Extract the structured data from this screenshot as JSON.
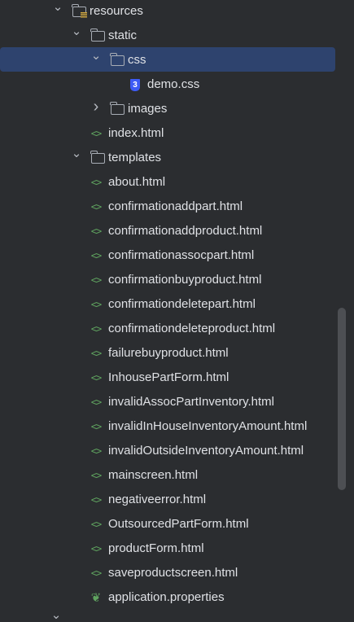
{
  "tree": [
    {
      "label": "resources",
      "type": "resources-folder",
      "depth": 0,
      "expanded": true
    },
    {
      "label": "static",
      "type": "folder",
      "depth": 1,
      "expanded": true
    },
    {
      "label": "css",
      "type": "folder",
      "depth": 2,
      "expanded": true,
      "selected": true
    },
    {
      "label": "demo.css",
      "type": "css",
      "depth": 3
    },
    {
      "label": "images",
      "type": "folder",
      "depth": 2,
      "expanded": false
    },
    {
      "label": "index.html",
      "type": "html",
      "depth": 2
    },
    {
      "label": "templates",
      "type": "folder",
      "depth": 1,
      "expanded": true
    },
    {
      "label": "about.html",
      "type": "html",
      "depth": 2
    },
    {
      "label": "confirmationaddpart.html",
      "type": "html",
      "depth": 2
    },
    {
      "label": "confirmationaddproduct.html",
      "type": "html",
      "depth": 2
    },
    {
      "label": "confirmationassocpart.html",
      "type": "html",
      "depth": 2
    },
    {
      "label": "confirmationbuyproduct.html",
      "type": "html",
      "depth": 2
    },
    {
      "label": "confirmationdeletepart.html",
      "type": "html",
      "depth": 2
    },
    {
      "label": "confirmationdeleteproduct.html",
      "type": "html",
      "depth": 2
    },
    {
      "label": "failurebuyproduct.html",
      "type": "html",
      "depth": 2
    },
    {
      "label": "InhousePartForm.html",
      "type": "html",
      "depth": 2
    },
    {
      "label": "invalidAssocPartInventory.html",
      "type": "html",
      "depth": 2
    },
    {
      "label": "invalidInHouseInventoryAmount.html",
      "type": "html",
      "depth": 2
    },
    {
      "label": "invalidOutsideInventoryAmount.html",
      "type": "html",
      "depth": 2
    },
    {
      "label": "mainscreen.html",
      "type": "html",
      "depth": 2
    },
    {
      "label": "negativeerror.html",
      "type": "html",
      "depth": 2
    },
    {
      "label": "OutsourcedPartForm.html",
      "type": "html",
      "depth": 2
    },
    {
      "label": "productForm.html",
      "type": "html",
      "depth": 2
    },
    {
      "label": "saveproductscreen.html",
      "type": "html",
      "depth": 2
    },
    {
      "label": "application.properties",
      "type": "spring-properties",
      "depth": 1
    }
  ],
  "colors": {
    "background": "#2b2d30",
    "selection": "#2e436e",
    "html_icon": "#5fa35f",
    "css_icon": "#3d5bf5",
    "text": "#dfe1e5"
  }
}
